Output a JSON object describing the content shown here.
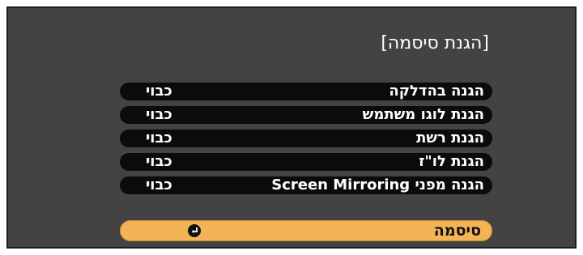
{
  "screen": {
    "title": "[הגנת סיסמה]"
  },
  "settings": [
    {
      "label": "הגנה בהדלקה",
      "value": "כבוי"
    },
    {
      "label": "הגנת לוגו משתמש",
      "value": "כבוי"
    },
    {
      "label": "הגנת רשת",
      "value": "כבוי"
    },
    {
      "label": "הגנת לו\"ז",
      "value": "כבוי"
    },
    {
      "label": "הגנה מפני Screen Mirroring",
      "value": "כבוי"
    }
  ],
  "password": {
    "label": "סיסמה",
    "icon": "enter-icon"
  },
  "colors": {
    "panel": "#434343",
    "row": "#0b0b0b",
    "highlight": "#f2b457"
  }
}
